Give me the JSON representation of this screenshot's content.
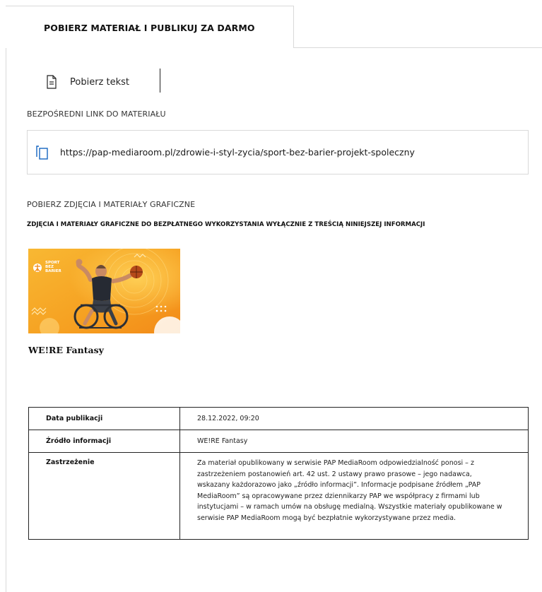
{
  "tab": {
    "label": "POBIERZ MATERIAŁ I PUBLIKUJ ZA DARMO"
  },
  "download": {
    "label": "Pobierz tekst",
    "icon": "document-icon"
  },
  "direct_link": {
    "heading": "BEZPOŚREDNI LINK DO MATERIAŁU",
    "url": "https://pap-mediaroom.pl/zdrowie-i-styl-zycia/sport-bez-barier-projekt-spoleczny",
    "icon": "copy-icon"
  },
  "photos": {
    "heading": "POBIERZ ZDJĘCIA I MATERIAŁY GRAFICZNE",
    "subheading": "ZDJĘCIA I MATERIAŁY GRAFICZNE DO BEZPŁATNEGO WYKORZYSTANIA WYŁĄCZNIE Z TREŚCIĄ NINIEJSZEJ INFORMACJI",
    "items": [
      {
        "logo_text": [
          "SPORT",
          "BEZ",
          "BARIER"
        ],
        "caption": "WE!RE Fantasy"
      }
    ]
  },
  "info_table": {
    "rows": [
      {
        "key": "Data publikacji",
        "value": "28.12.2022, 09:20"
      },
      {
        "key": "Źródło informacji",
        "value": "WE!RE Fantasy"
      },
      {
        "key": "Zastrzeżenie",
        "value": "Za materiał opublikowany w serwisie PAP MediaRoom odpowiedzialność ponosi – z zastrzeżeniem postanowień art. 42 ust. 2 ustawy prawo prasowe – jego nadawca, wskazany każdorazowo jako „źródło informacji”. Informacje podpisane źródłem „PAP MediaRoom” są opracowywane przez dziennikarzy PAP we współpracy z firmami lub instytucjami – w ramach umów na obsługę medialną. Wszystkie materiały opublikowane w serwisie PAP MediaRoom mogą być bezpłatnie wykorzystywane przez media."
      }
    ]
  },
  "colors": {
    "thumb_gradient_start": "#f7b733",
    "thumb_gradient_end": "#f48a1a",
    "copy_icon": "#1565c0",
    "border": "#d9d9d9"
  }
}
